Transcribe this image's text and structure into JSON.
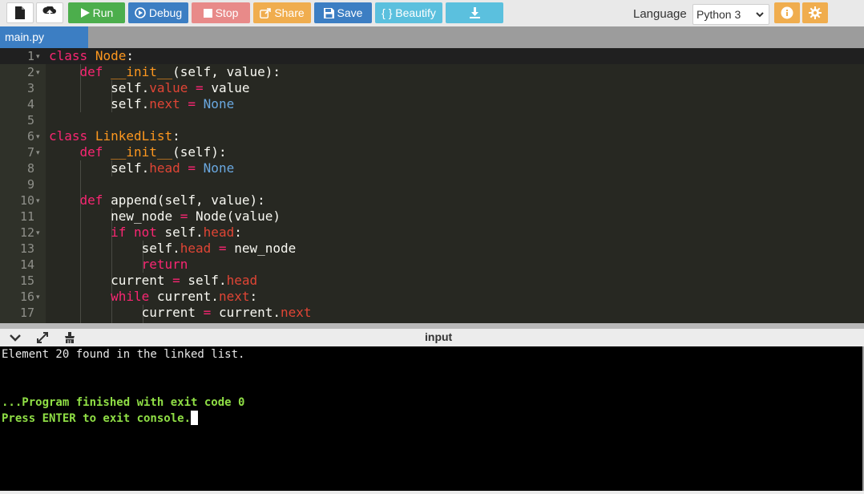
{
  "toolbar": {
    "buttons": {
      "file": {
        "icon": "file-icon"
      },
      "upload": {
        "icon": "upload-icon"
      },
      "run": {
        "label": "Run",
        "icon": "play-icon",
        "color": "#4cae4c"
      },
      "debug": {
        "label": "Debug",
        "icon": "debug-icon",
        "color": "#3c7ec3"
      },
      "stop": {
        "label": "Stop",
        "icon": "stop-icon",
        "color": "#e88a89"
      },
      "share": {
        "label": "Share",
        "icon": "share-icon",
        "color": "#f0ad4e"
      },
      "save": {
        "label": "Save",
        "icon": "save-icon",
        "color": "#3c7ec3"
      },
      "beautify": {
        "label": "{ } Beautify",
        "color": "#5bc0de"
      },
      "download": {
        "icon": "download-icon",
        "color": "#5bc0de"
      }
    },
    "language_label": "Language",
    "language_value": "Python 3",
    "info_icon": "info-icon",
    "settings_icon": "gear-icon"
  },
  "tabs": [
    {
      "label": "main.py",
      "active": true
    }
  ],
  "editor": {
    "lines": [
      {
        "n": "1",
        "fold": true
      },
      {
        "n": "2",
        "fold": true
      },
      {
        "n": "3"
      },
      {
        "n": "4"
      },
      {
        "n": "5"
      },
      {
        "n": "6",
        "fold": true
      },
      {
        "n": "7",
        "fold": true
      },
      {
        "n": "8"
      },
      {
        "n": "9"
      },
      {
        "n": "10",
        "fold": true
      },
      {
        "n": "11"
      },
      {
        "n": "12",
        "fold": true
      },
      {
        "n": "13"
      },
      {
        "n": "14"
      },
      {
        "n": "15"
      },
      {
        "n": "16",
        "fold": true
      },
      {
        "n": "17"
      }
    ],
    "code_tokens": {
      "l1": [
        "class",
        "Node",
        ":"
      ],
      "l2": [
        "def",
        "__init__",
        "(self, value):"
      ],
      "l3": [
        "self.",
        "value",
        " = ",
        "value"
      ],
      "l4": [
        "self.",
        "next",
        " = ",
        "None"
      ],
      "l6": [
        "class",
        "LinkedList",
        ":"
      ],
      "l7": [
        "def",
        "__init__",
        "(self):"
      ],
      "l8": [
        "self.",
        "head",
        " = ",
        "None"
      ],
      "l10": [
        "def",
        "append",
        "(self, value):"
      ],
      "l11": [
        "new_node",
        " = ",
        "Node(value)"
      ],
      "l12": [
        "if",
        " not ",
        "self.",
        "head",
        ":"
      ],
      "l13": [
        "self.",
        "head",
        " = ",
        "new_node"
      ],
      "l14": [
        "return"
      ],
      "l15": [
        "current",
        " = ",
        "self.",
        "head"
      ],
      "l16": [
        "while",
        " current.",
        "next",
        ":"
      ],
      "l17": [
        "current",
        " = ",
        "current.",
        "next"
      ]
    }
  },
  "console": {
    "header_title": "input",
    "header_icons": [
      "chevron-down-icon",
      "expand-icon",
      "clear-console-icon"
    ],
    "output": [
      {
        "text": "Element 20 found in the linked list.",
        "style": "white"
      },
      {
        "text": "",
        "style": "white"
      },
      {
        "text": "",
        "style": "white"
      },
      {
        "text": "...Program finished with exit code 0",
        "style": "green"
      },
      {
        "text": "Press ENTER to exit console.",
        "style": "green"
      }
    ]
  }
}
